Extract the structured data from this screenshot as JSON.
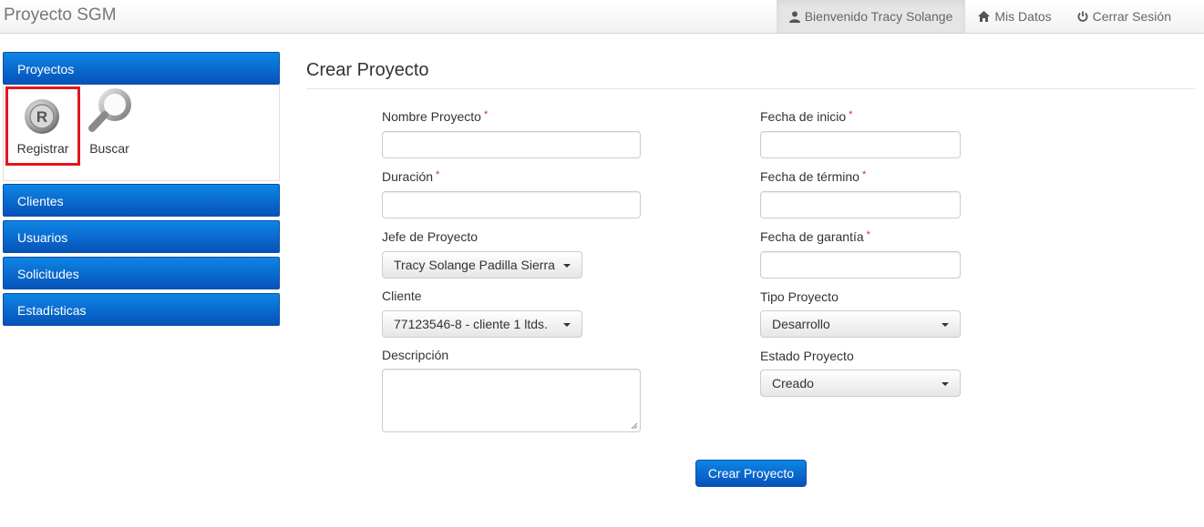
{
  "app": {
    "brand": "Proyecto SGM"
  },
  "navbar": {
    "welcome": "Bienvenido Tracy Solange",
    "my_data": "Mis Datos",
    "logout": "Cerrar Sesión",
    "icons": [
      "user-icon",
      "home-icon",
      "power-icon"
    ]
  },
  "sidebar": {
    "proyectos": "Proyectos",
    "tools": [
      {
        "label": "Registrar",
        "icon": "registered-icon",
        "selected": true
      },
      {
        "label": "Buscar",
        "icon": "magnifier-icon"
      }
    ],
    "items": [
      "Clientes",
      "Usuarios",
      "Solicitudes",
      "Estadísticas"
    ]
  },
  "main": {
    "title": "Crear Proyecto",
    "required_mark": "*",
    "fields": {
      "nombre": {
        "label": "Nombre Proyecto",
        "value": ""
      },
      "duracion": {
        "label": "Duración",
        "value": ""
      },
      "jefe": {
        "label": "Jefe de Proyecto",
        "value": "Tracy Solange Padilla Sierra"
      },
      "cliente": {
        "label": "Cliente",
        "value": "77123546-8 - cliente 1 ltds."
      },
      "descripcion": {
        "label": "Descripción",
        "value": ""
      },
      "fecha_inicio": {
        "label": "Fecha de inicio",
        "value": ""
      },
      "fecha_termino": {
        "label": "Fecha de término",
        "value": ""
      },
      "fecha_garantia": {
        "label": "Fecha de garantía",
        "value": ""
      },
      "tipo": {
        "label": "Tipo Proyecto",
        "value": "Desarrollo"
      },
      "estado": {
        "label": "Estado Proyecto",
        "value": "Creado"
      }
    },
    "submit": "Crear Proyecto"
  },
  "colors": {
    "primary": "#0752b8",
    "primary_light": "#0d86e6",
    "required": "#c9302c",
    "highlight": "#e3161c"
  }
}
